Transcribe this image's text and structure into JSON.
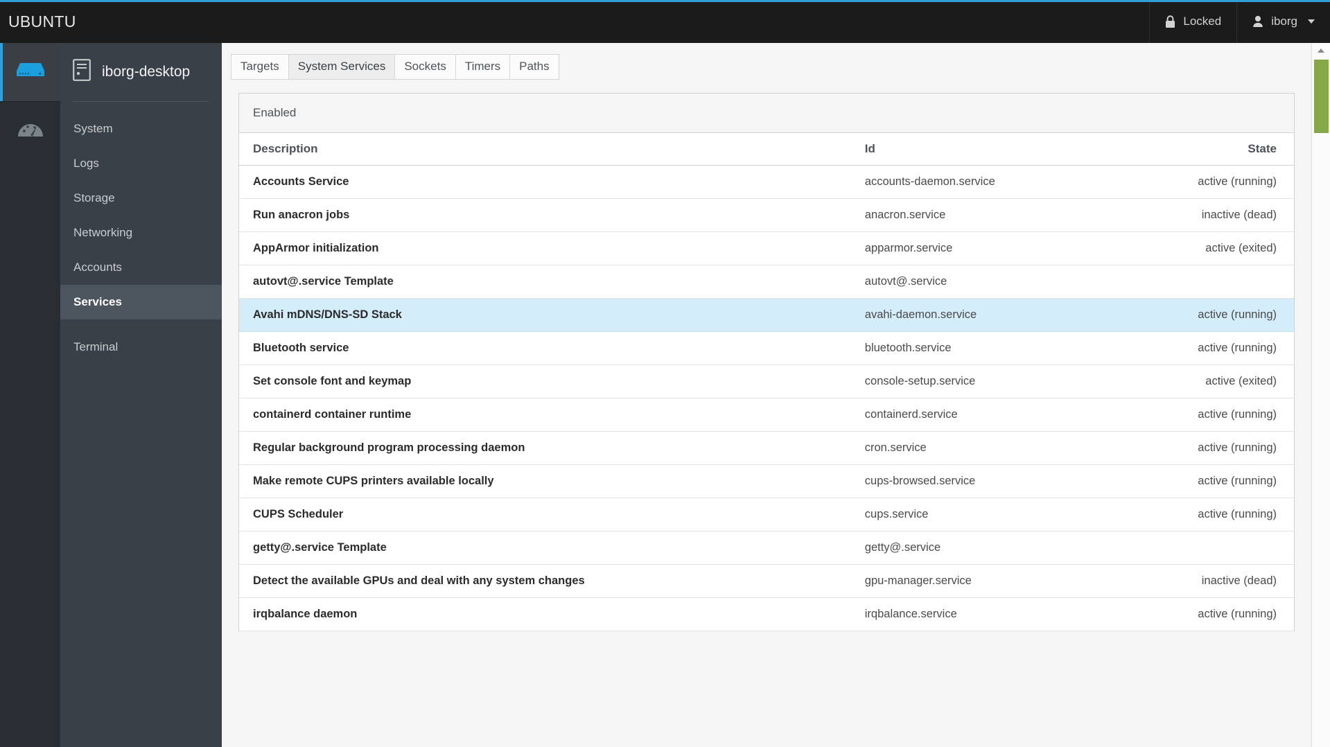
{
  "topbar": {
    "brand": "UBUNTU",
    "lock": {
      "label": "Locked",
      "icon": "lock-icon"
    },
    "user": {
      "label": "iborg",
      "icon": "user-icon"
    },
    "accent_color": "#2f9fd4",
    "background_color": "#1b1b1b"
  },
  "rail": {
    "items": [
      {
        "name": "server-icon",
        "label": "Server",
        "active": true
      },
      {
        "name": "dashboard-icon",
        "label": "Dashboard",
        "active": false
      }
    ]
  },
  "sidebar": {
    "host": {
      "label": "iborg-desktop",
      "icon": "server-tower-icon"
    },
    "items": [
      {
        "label": "System",
        "active": false
      },
      {
        "label": "Logs",
        "active": false
      },
      {
        "label": "Storage",
        "active": false
      },
      {
        "label": "Networking",
        "active": false
      },
      {
        "label": "Accounts",
        "active": false
      },
      {
        "label": "Services",
        "active": true
      },
      {
        "label": "Terminal",
        "active": false
      }
    ]
  },
  "main": {
    "tabs": [
      {
        "label": "Targets",
        "active": false
      },
      {
        "label": "System Services",
        "active": true
      },
      {
        "label": "Sockets",
        "active": false
      },
      {
        "label": "Timers",
        "active": false
      },
      {
        "label": "Paths",
        "active": false
      }
    ],
    "panel_heading": "Enabled",
    "columns": {
      "description": "Description",
      "id": "Id",
      "state": "State"
    },
    "rows": [
      {
        "description": "Accounts Service",
        "id": "accounts-daemon.service",
        "state": "active (running)",
        "selected": false
      },
      {
        "description": "Run anacron jobs",
        "id": "anacron.service",
        "state": "inactive (dead)",
        "selected": false
      },
      {
        "description": "AppArmor initialization",
        "id": "apparmor.service",
        "state": "active (exited)",
        "selected": false
      },
      {
        "description": "autovt@.service Template",
        "id": "autovt@.service",
        "state": "",
        "selected": false
      },
      {
        "description": "Avahi mDNS/DNS-SD Stack",
        "id": "avahi-daemon.service",
        "state": "active (running)",
        "selected": true
      },
      {
        "description": "Bluetooth service",
        "id": "bluetooth.service",
        "state": "active (running)",
        "selected": false
      },
      {
        "description": "Set console font and keymap",
        "id": "console-setup.service",
        "state": "active (exited)",
        "selected": false
      },
      {
        "description": "containerd container runtime",
        "id": "containerd.service",
        "state": "active (running)",
        "selected": false
      },
      {
        "description": "Regular background program processing daemon",
        "id": "cron.service",
        "state": "active (running)",
        "selected": false
      },
      {
        "description": "Make remote CUPS printers available locally",
        "id": "cups-browsed.service",
        "state": "active (running)",
        "selected": false
      },
      {
        "description": "CUPS Scheduler",
        "id": "cups.service",
        "state": "active (running)",
        "selected": false
      },
      {
        "description": "getty@.service Template",
        "id": "getty@.service",
        "state": "",
        "selected": false
      },
      {
        "description": "Detect the available GPUs and deal with any system changes",
        "id": "gpu-manager.service",
        "state": "inactive (dead)",
        "selected": false
      },
      {
        "description": "irqbalance daemon",
        "id": "irqbalance.service",
        "state": "active (running)",
        "selected": false
      }
    ],
    "selected_row_color": "#d4edfa"
  },
  "scrollbar": {
    "thumb_color": "#85a947",
    "position": "top"
  }
}
